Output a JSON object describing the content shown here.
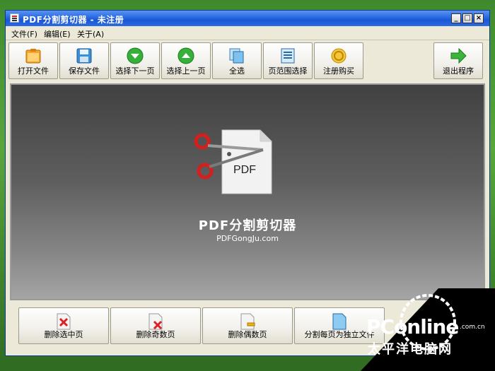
{
  "window": {
    "title": "PDF分割剪切器 - 未注册",
    "controls": [
      "_",
      "□",
      "×"
    ]
  },
  "menu": [
    {
      "label": "文件(F)"
    },
    {
      "label": "编辑(E)"
    },
    {
      "label": "关于(A)"
    }
  ],
  "toolbar": [
    {
      "label": "打开文件",
      "icon": "folder-open-icon"
    },
    {
      "label": "保存文件",
      "icon": "floppy-disk-icon"
    },
    {
      "label": "选择下一页",
      "icon": "arrow-down-circle-icon"
    },
    {
      "label": "选择上一页",
      "icon": "arrow-up-circle-icon"
    },
    {
      "label": "全选",
      "icon": "select-all-pages-icon"
    },
    {
      "label": "页范围选择",
      "icon": "page-range-icon"
    },
    {
      "label": "注册购买",
      "icon": "coin-icon"
    },
    {
      "label": "退出程序",
      "icon": "arrow-right-icon"
    }
  ],
  "display": {
    "logo_text": "PDF",
    "product_name": "PDF分割剪切器",
    "product_url": "PDFGongJu.com"
  },
  "bottom_actions": [
    {
      "label": "删除选中页",
      "icon": "delete-page-icon"
    },
    {
      "label": "删除奇数页",
      "icon": "delete-odd-pages-icon"
    },
    {
      "label": "删除偶数页",
      "icon": "delete-even-pages-icon"
    },
    {
      "label": "分割每页为独立文件",
      "icon": "split-pages-icon"
    }
  ],
  "watermark": {
    "brand": "PConline",
    "domain": ".com.cn",
    "chinese": "太平洋电脑网"
  },
  "colors": {
    "titlebar": "#2d6ee5",
    "window_bg": "#ece9d8",
    "display_top": "#414141",
    "display_bottom": "#a5a5a5",
    "accent_green": "#2fa02f"
  }
}
